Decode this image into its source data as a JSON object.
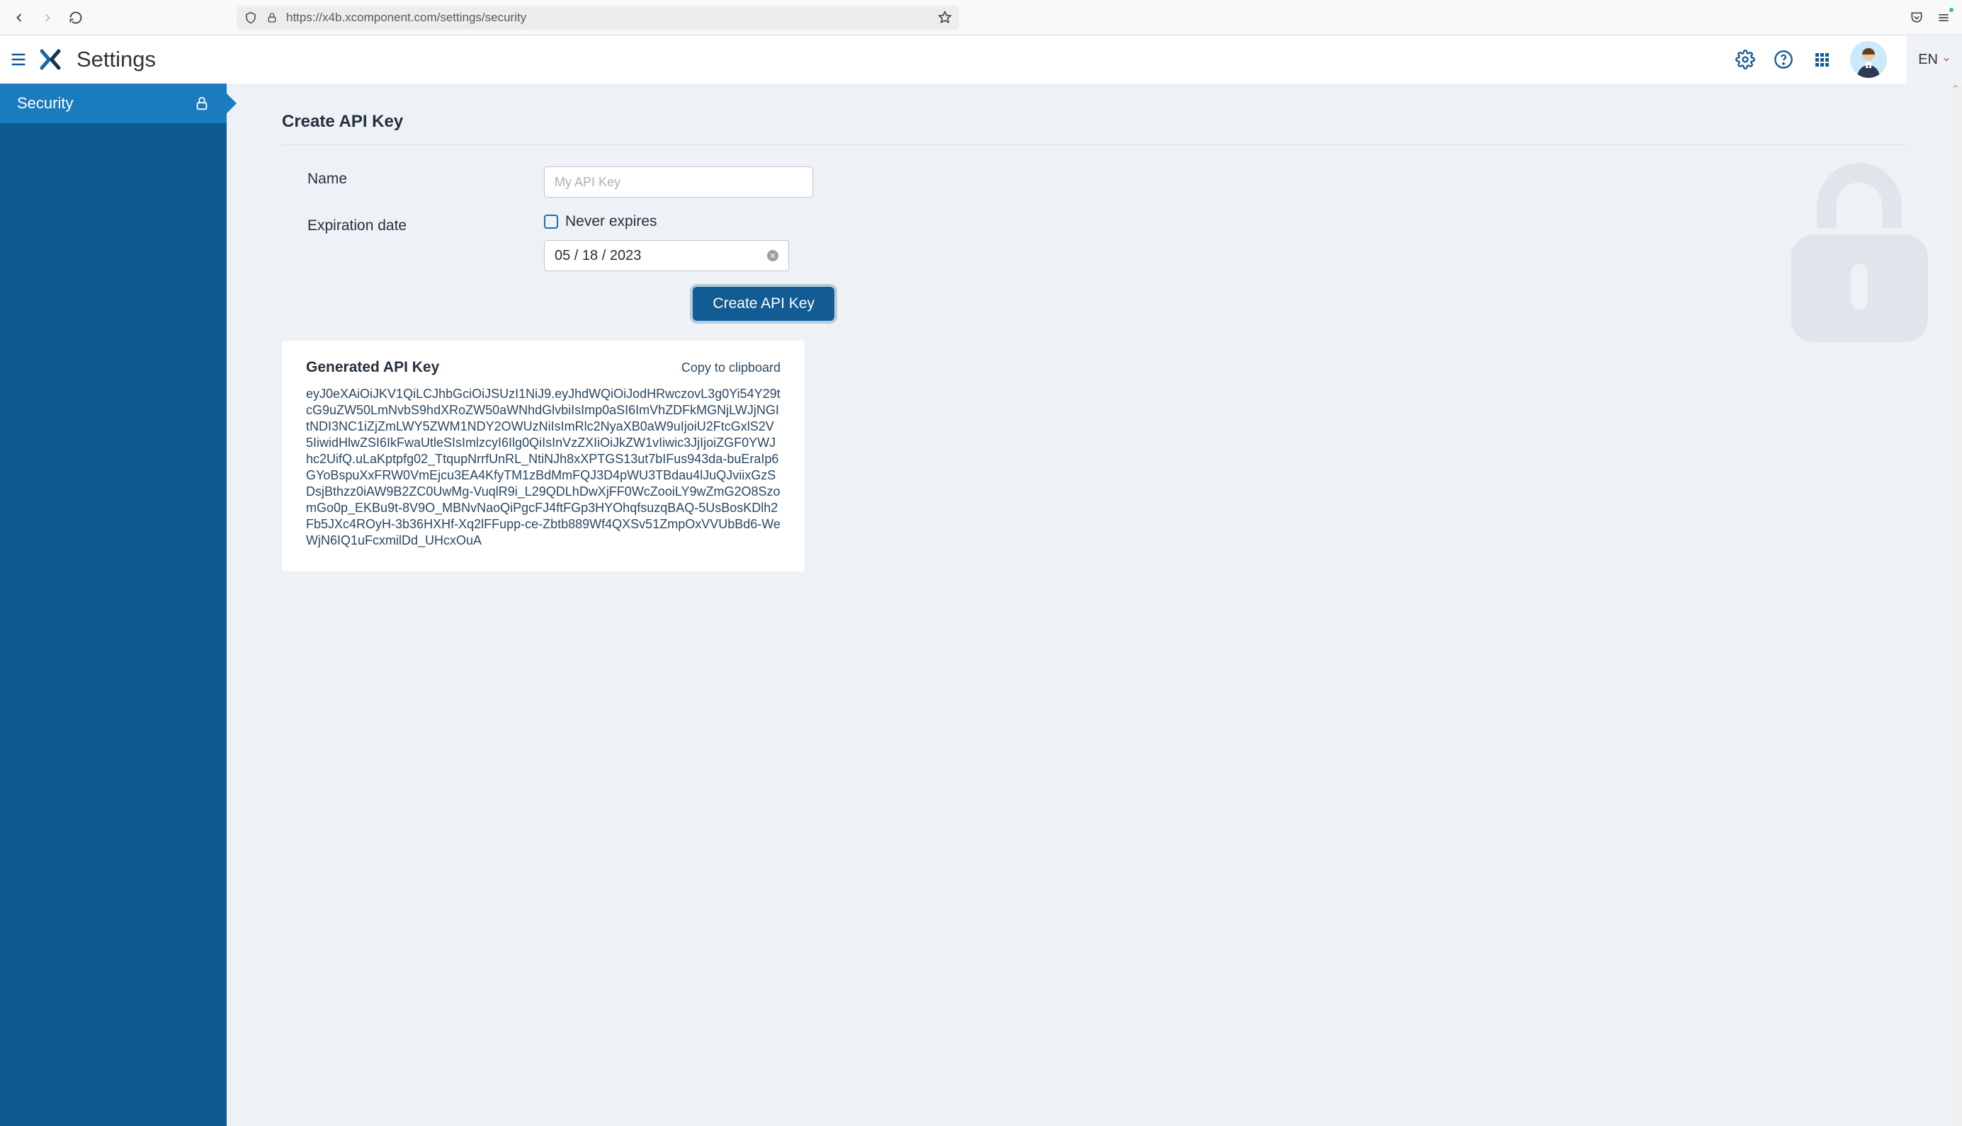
{
  "browser": {
    "url": "https://x4b.xcomponent.com/settings/security"
  },
  "header": {
    "page_title": "Settings",
    "language": "EN"
  },
  "sidebar": {
    "items": [
      {
        "label": "Security"
      }
    ]
  },
  "form": {
    "section_title": "Create API Key",
    "name_label": "Name",
    "name_placeholder": "My API Key",
    "name_value": "",
    "expiration_label": "Expiration date",
    "never_expires_label": "Never expires",
    "date_value": "05 / 18 / 2023",
    "submit_label": "Create API Key"
  },
  "generated": {
    "title": "Generated API Key",
    "copy_label": "Copy to clipboard",
    "key": "eyJ0eXAiOiJKV1QiLCJhbGciOiJSUzI1NiJ9.eyJhdWQiOiJodHRwczovL3g0Yi54Y29tcG9uZW50LmNvbS9hdXRoZW50aWNhdGlvbiIsImp0aSI6ImVhZDFkMGNjLWJjNGItNDI3NC1iZjZmLWY5ZWM1NDY2OWUzNiIsImRlc2NyaXB0aW9uIjoiU2FtcGxlS2V5IiwidHlwZSI6IkFwaUtleSIsImlzcyI6Ilg0QiIsInVzZXIiOiJkZW1vIiwic3JjIjoiZGF0YWJhc2UifQ.uLaKptpfg02_TtqupNrrfUnRL_NtiNJh8xXPTGS13ut7bIFus943da-buEraIp6GYoBspuXxFRW0VmEjcu3EA4KfyTM1zBdMmFQJ3D4pWU3TBdau4lJuQJviixGzSDsjBthzz0iAW9B2ZC0UwMg-VuqlR9i_L29QDLhDwXjFF0WcZooiLY9wZmG2O8SzomGo0p_EKBu9t-8V9O_MBNvNaoQiPgcFJ4ftFGp3HYOhqfsuzqBAQ-5UsBosKDlh2Fb5JXc4ROyH-3b36HXHf-Xq2lFFupp-ce-Zbtb889Wf4QXSv51ZmpOxVVUbBd6-WeWjN6IQ1uFcxmilDd_UHcxOuA"
  }
}
